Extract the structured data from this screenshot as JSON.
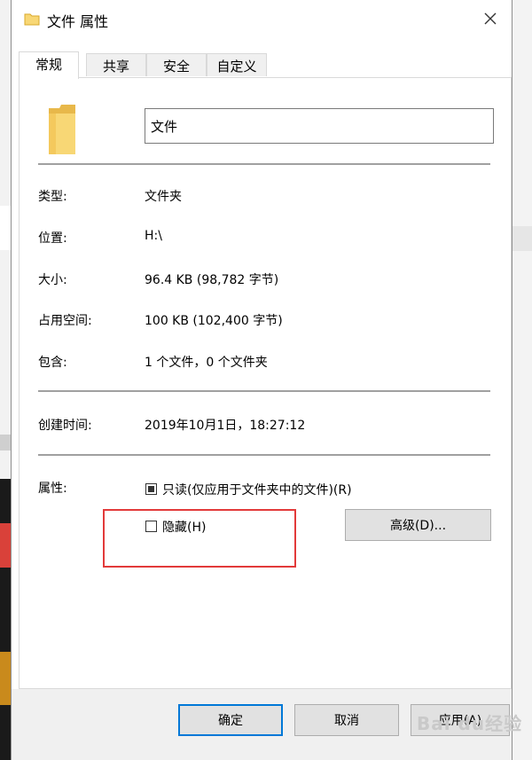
{
  "window": {
    "title": "文件 属性"
  },
  "tabs": [
    {
      "label": "常规"
    },
    {
      "label": "共享"
    },
    {
      "label": "安全"
    },
    {
      "label": "自定义"
    }
  ],
  "general": {
    "name_value": "文件",
    "rows": [
      {
        "label": "类型:",
        "value": "文件夹"
      },
      {
        "label": "位置:",
        "value": "H:\\"
      },
      {
        "label": "大小:",
        "value": "96.4 KB (98,782 字节)"
      },
      {
        "label": "占用空间:",
        "value": "100 KB (102,400 字节)"
      },
      {
        "label": "包含:",
        "value": "1 个文件，0 个文件夹"
      }
    ],
    "created": {
      "label": "创建时间:",
      "value": "2019年10月1日，18:27:12"
    },
    "attributes_label": "属性:",
    "readonly_label": "只读(仅应用于文件夹中的文件)(R)",
    "hidden_label": "隐藏(H)",
    "advanced_button": "高级(D)..."
  },
  "footer": {
    "ok": "确定",
    "cancel": "取消",
    "apply": "应用(A)"
  },
  "watermark": "Bai du经验",
  "colors": {
    "folder_yellow": "#f8d775",
    "annotation_red": "#e23a3a",
    "focus_blue": "#0078d7"
  }
}
